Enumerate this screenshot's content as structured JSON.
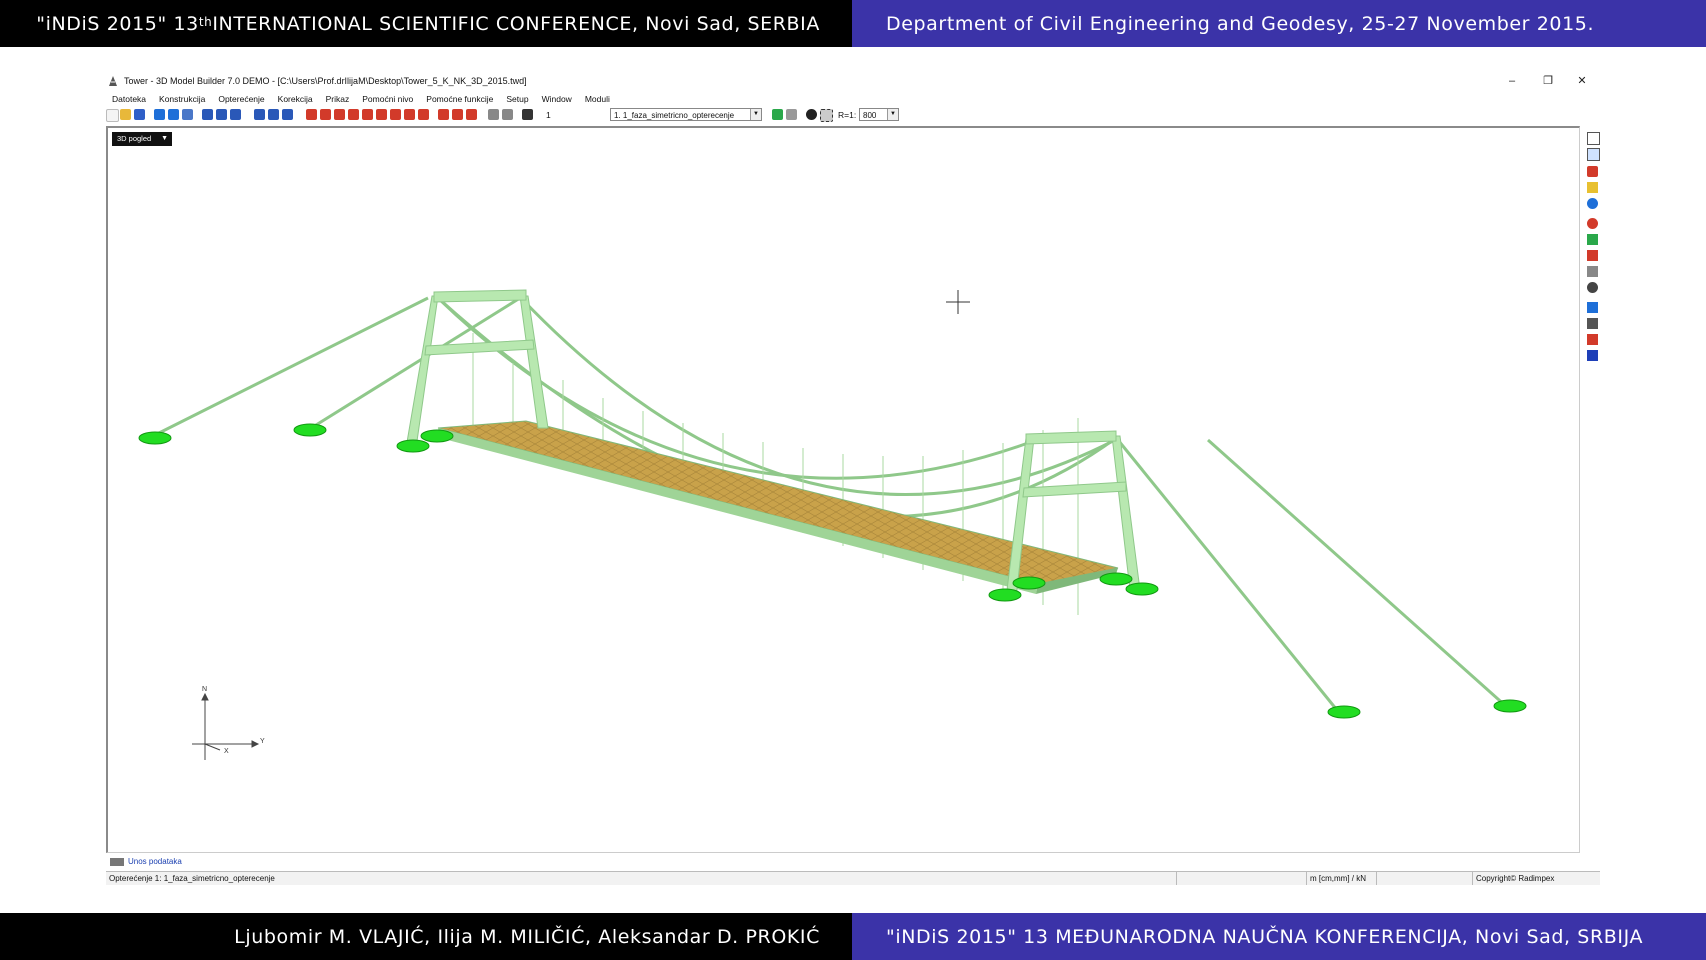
{
  "header": {
    "left_prefix": "\"iNDiS 2015\" 13",
    "left_sup": "th",
    "left_suffix": " INTERNATIONAL SCIENTIFIC CONFERENCE, Novi Sad, SERBIA",
    "right": "Department of Civil Engineering and Geodesy, 25-27 November 2015."
  },
  "footer": {
    "left": "Ljubomir M. VLAJIĆ, Ilija M. MILIČIĆ, Aleksandar D. PROKIĆ",
    "right": "\"iNDiS 2015\" 13 MEĐUNARODNA NAUČNA KONFERENCIJA, Novi Sad, SRBIJA"
  },
  "window": {
    "title": "Tower - 3D Model Builder 7.0 DEMO - [C:\\Users\\Prof.drIlijaM\\Desktop\\Tower_5_K_NK_3D_2015.twd]",
    "controls": {
      "minimize": "–",
      "maximize": "❐",
      "close": "✕"
    }
  },
  "menu": [
    "Datoteka",
    "Konstrukcija",
    "Opterećenje",
    "Korekcija",
    "Prikaz",
    "Pomoćni nivo",
    "Pomoćne funkcije",
    "Setup",
    "Window",
    "Moduli"
  ],
  "toolbar": {
    "case_number": "1",
    "load_case": "1. 1_faza_simetricno_opterecenje",
    "scale_label": "R=1:",
    "scale_value": "800"
  },
  "viewport": {
    "view_mode": "3D pogled",
    "axis_labels": {
      "z": "N",
      "y": "Y",
      "x": "X"
    }
  },
  "bottom_tab": "Unos podataka",
  "status": {
    "load_case": "Opterećenje 1: 1_faza_simetricno_opterecenje",
    "units": "m [cm,mm] / kN",
    "copyright": "Copyright© Radimpex"
  },
  "colors": {
    "header_left_bg": "#000000",
    "header_right_bg": "#3b33a8",
    "structure": "#b8e8b0",
    "deck": "#c8a84a",
    "supports": "#22dd22"
  }
}
